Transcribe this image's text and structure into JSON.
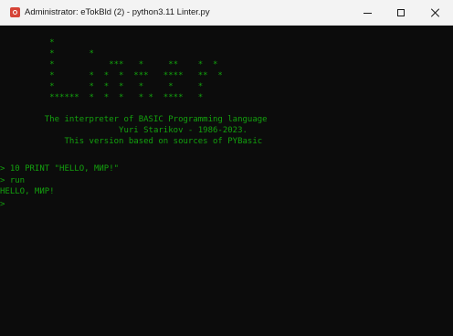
{
  "window": {
    "title": "Administrator: eTokBld (2) - python3.11  Linter.py",
    "controls": {
      "minimize_icon": "minimize-icon",
      "maximize_icon": "maximize-icon",
      "close_icon": "close-icon"
    }
  },
  "console": {
    "text_color": "#13a10e",
    "background": "#0c0c0c",
    "banner": [
      "          *",
      "          *       *",
      "          *           ***   *     **    *  *",
      "          *       *  *  *  ***   ****   **  *",
      "          *       *  *  *   *     *     *",
      "          ******  *  *  *   * *  ****   *",
      "         The interpreter of BASIC Programming language",
      "                        Yuri Starikov - 1986-2023.",
      "             This version based on sources of PYBasic"
    ],
    "session": [
      "> 10 PRINT \"HELLO, МИР!\"",
      "> run",
      "HELLO, МИР!",
      ">"
    ]
  }
}
